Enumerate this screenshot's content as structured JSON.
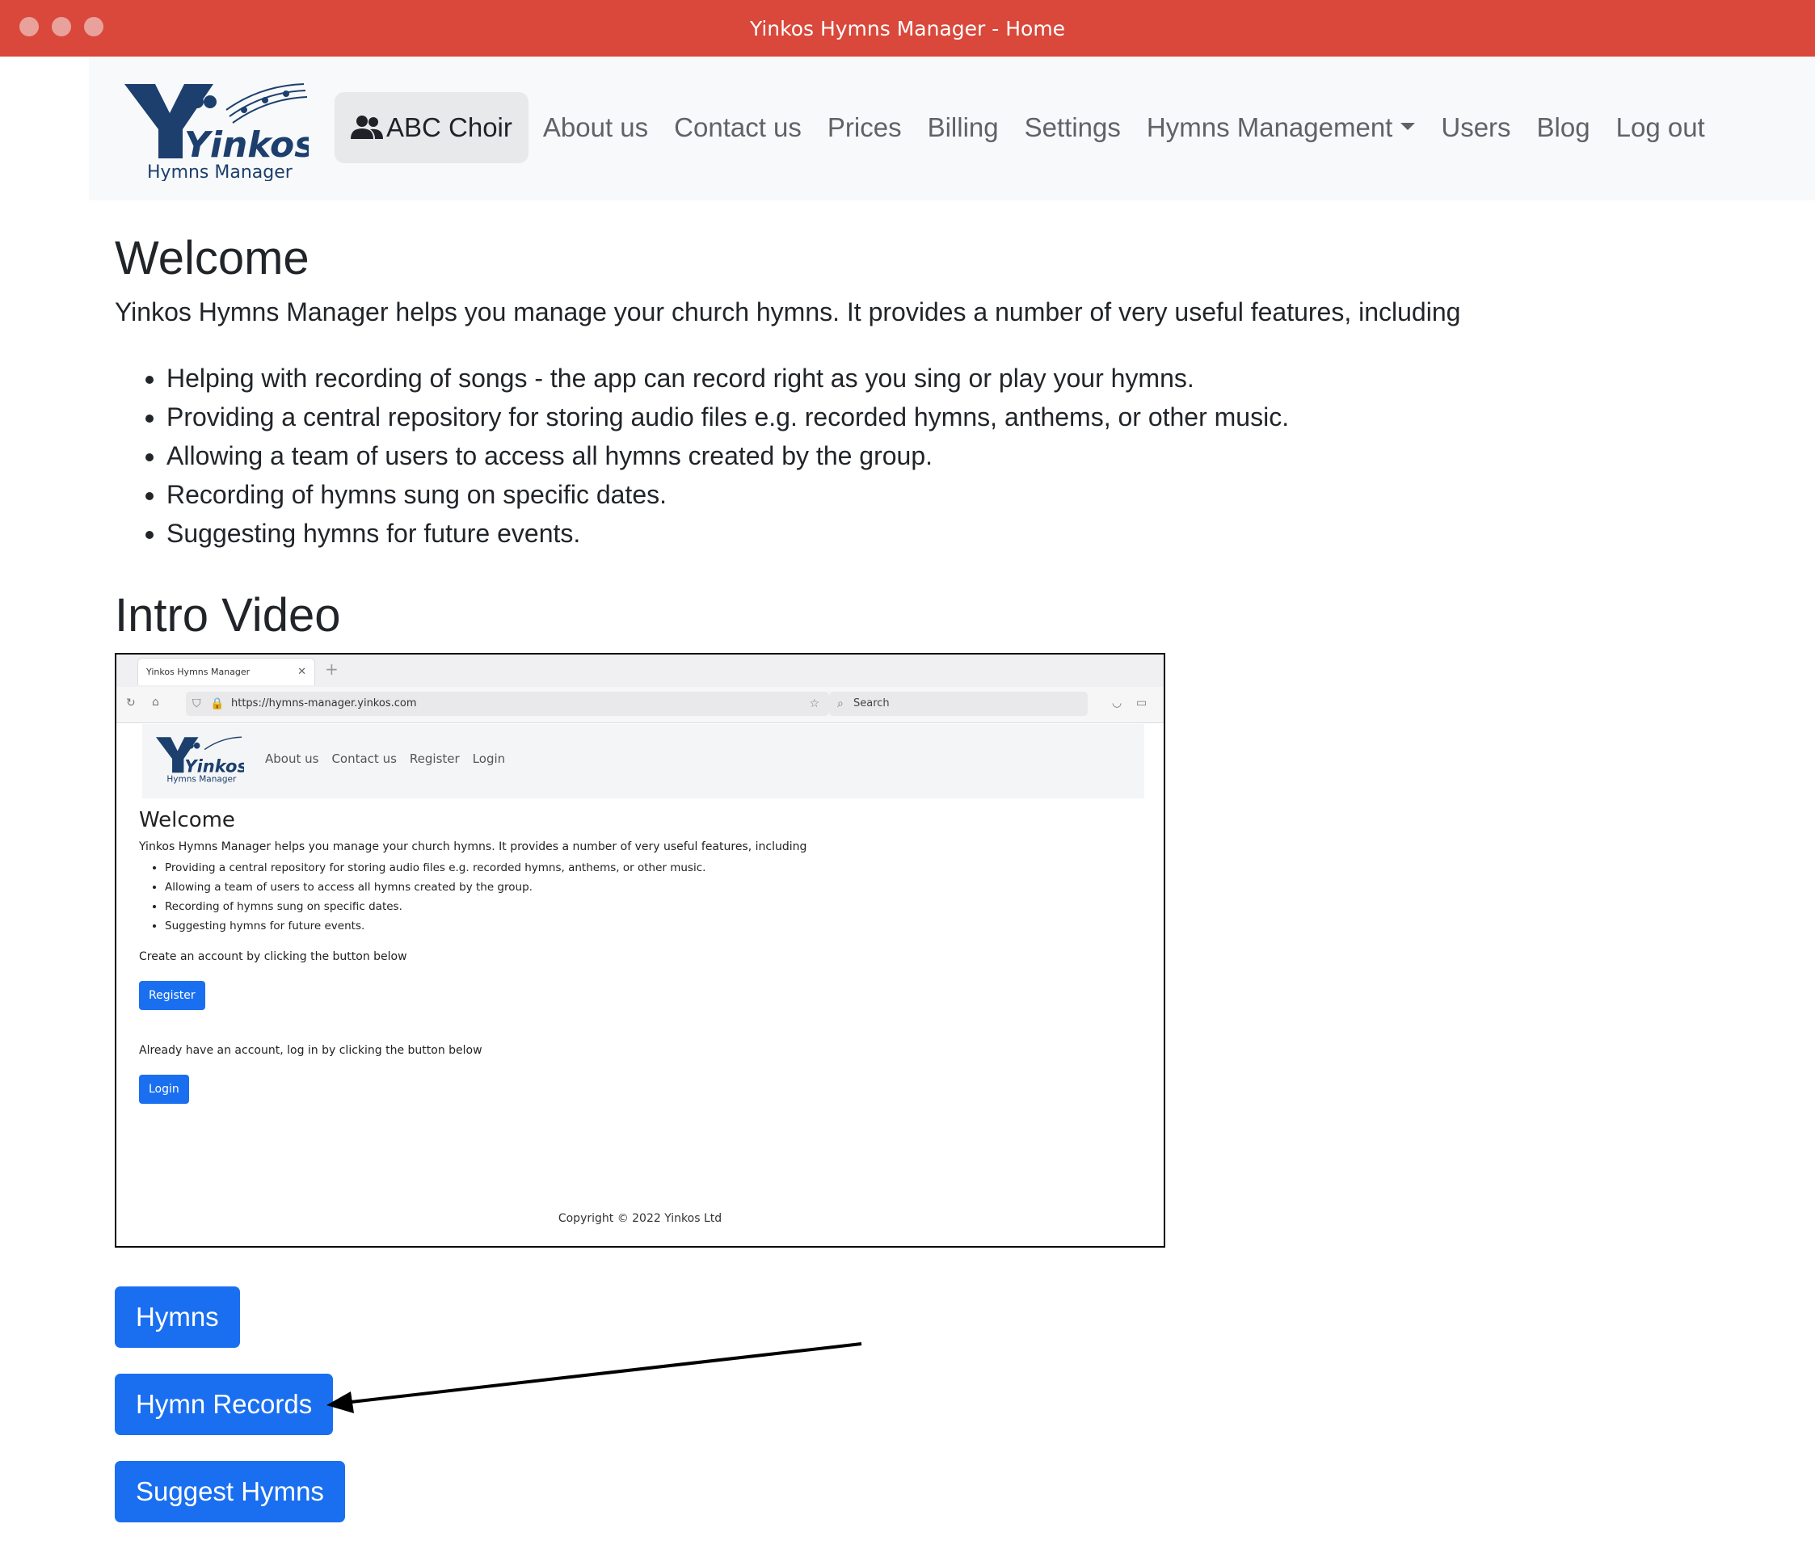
{
  "window": {
    "title": "Yinkos Hymns Manager - Home"
  },
  "brand": {
    "logo_name": "Yinkos",
    "logo_subtitle": "Hymns Manager"
  },
  "nav": {
    "items": [
      {
        "label": "ABC Choir",
        "icon": "users-icon",
        "active": true
      },
      {
        "label": "About us"
      },
      {
        "label": "Contact us"
      },
      {
        "label": "Prices"
      },
      {
        "label": "Billing"
      },
      {
        "label": "Settings"
      },
      {
        "label": "Hymns Management",
        "dropdown": true
      },
      {
        "label": "Users"
      },
      {
        "label": "Blog"
      },
      {
        "label": "Log out"
      }
    ]
  },
  "main": {
    "welcome_title": "Welcome",
    "intro": "Yinkos Hymns Manager helps you manage your church hymns. It provides a number of very useful features, including",
    "features": [
      "Helping with recording of songs - the app can record right as you sing or play your hymns.",
      "Providing a central repository for storing audio files e.g. recorded hymns, anthems, or other music.",
      "Allowing a team of users to access all hymns created by the group.",
      "Recording of hymns sung on specific dates.",
      "Suggesting hymns for future events."
    ],
    "video_title": "Intro Video",
    "buttons": {
      "hymns": "Hymns",
      "hymn_records": "Hymn Records",
      "suggest_hymns": "Suggest Hymns"
    }
  },
  "video": {
    "tab_title": "Yinkos Hymns Manager",
    "url": "https://hymns-manager.yinkos.com",
    "search_placeholder": "Search",
    "nav_links": [
      "About us",
      "Contact us",
      "Register",
      "Login"
    ],
    "welcome": "Welcome",
    "intro": "Yinkos Hymns Manager helps you manage your church hymns. It provides a number of very useful features, including",
    "features": [
      "Providing a central repository for storing audio files e.g. recorded hymns, anthems, or other music.",
      "Allowing a team of users to access all hymns created by the group.",
      "Recording of hymns sung on specific dates.",
      "Suggesting hymns for future events."
    ],
    "create_text": "Create an account by clicking the button below",
    "register_label": "Register",
    "login_text": "Already have an account, log in by clicking the button below",
    "login_label": "Login",
    "footer": "Copyright © 2022 Yinkos Ltd"
  },
  "colors": {
    "titlebar": "#d9483b",
    "primary": "#1a6ff0",
    "navbar_bg": "#f8f9fa"
  }
}
